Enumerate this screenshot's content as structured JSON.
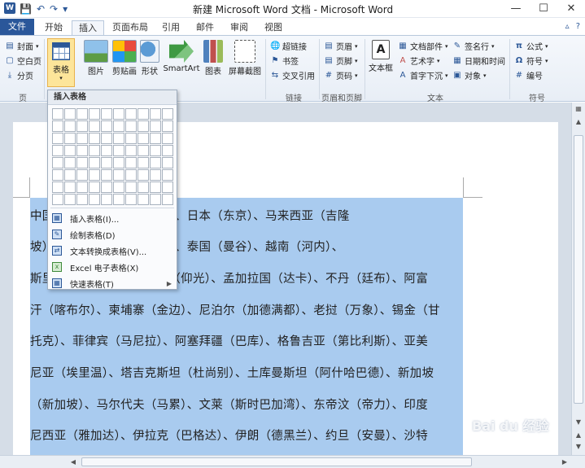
{
  "window": {
    "title": "新建 Microsoft Word 文档 - Microsoft Word",
    "logo": "W",
    "controls": {
      "minimize": "—",
      "maximize": "☐",
      "close": "✕"
    }
  },
  "qat": {
    "save": "💾",
    "undo": "↶",
    "redo": "↷",
    "customize": "▾"
  },
  "tabs": {
    "file": "文件",
    "items": [
      "开始",
      "插入",
      "页面布局",
      "引用",
      "邮件",
      "审阅",
      "视图"
    ],
    "active": "插入"
  },
  "ribbon": {
    "pages_group": {
      "cover": "封面",
      "blank": "空白页",
      "break": "分页",
      "label": "页"
    },
    "table_button": "表格",
    "illustrations": {
      "picture": "图片",
      "clipart": "剪贴画",
      "shapes": "形状",
      "smartart": "SmartArt",
      "chart": "图表",
      "screenshot": "屏幕截图"
    },
    "links_group": {
      "hyperlink": "超链接",
      "bookmark": "书签",
      "crossref": "交叉引用",
      "label": "链接"
    },
    "header_footer": {
      "header": "页眉",
      "footer": "页脚",
      "page_number": "页码",
      "label": "页眉和页脚"
    },
    "text_group": {
      "textbox": "文本框",
      "quickparts": "文档部件",
      "wordart": "艺术字",
      "dropcap": "首字下沉",
      "signature": "签名行",
      "datetime": "日期和时间",
      "object": "对象",
      "label": "文本"
    },
    "symbols_group": {
      "equation": "公式",
      "symbol": "符号",
      "number": "编号",
      "label": "符号"
    }
  },
  "dropdown": {
    "header": "插入表格",
    "grid": {
      "rows": 8,
      "cols": 10
    },
    "items": [
      "插入表格(I)...",
      "绘制表格(D)",
      "文本转换成表格(V)...",
      "Excel 电子表格(X)",
      "快速表格(T)"
    ]
  },
  "document": {
    "lines": [
      "中国（北京）、朝鲜（平壤）、日本（东京）、马来西亚（吉隆",
      "坡）、巴基斯坦（伊斯兰堡）、泰国（曼谷）、越南（河内）、",
      "斯里兰卡（科伦坡）、缅甸（仰光）、孟加拉国（达卡）、不丹（廷布）、阿富",
      "汗（喀布尔）、柬埔寨（金边）、尼泊尔（加德满都）、老挝（万象）、锡金（甘",
      "托克）、菲律宾（马尼拉）、阿塞拜疆（巴库）、格鲁吉亚（第比利斯）、亚美",
      "尼亚（埃里温）、塔吉克斯坦（杜尚别）、土库曼斯坦（阿什哈巴德）、新加坡",
      "（新加坡）、马尔代夫（马累）、文莱（斯时巴加湾）、东帝汶（帝力）、印度",
      "尼西亚（雅加达）、伊拉克（巴格达）、伊朗（德黑兰）、约旦（安曼）、沙特"
    ]
  },
  "watermark": "Bai du 经验"
}
